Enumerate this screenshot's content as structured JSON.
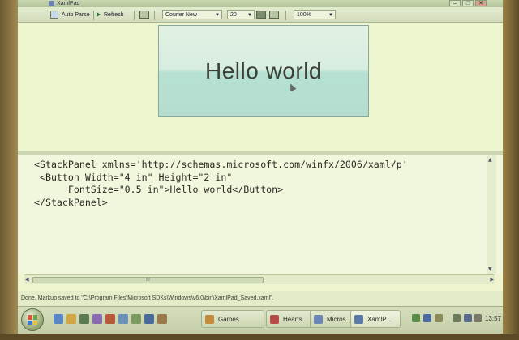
{
  "window": {
    "title": "XamlPad",
    "buttons": [
      "–",
      "□",
      "✕"
    ]
  },
  "toolbar": {
    "auto_parse_label": "Auto Parse",
    "refresh_label": "Refresh",
    "font_family": "Courier New",
    "font_size": "20",
    "zoom": "100%"
  },
  "preview": {
    "button_text": "Hello world"
  },
  "editor": {
    "lines": [
      "<StackPanel xmlns='http://schemas.microsoft.com/winfx/2006/xaml/p'",
      " <Button Width=\"4 in\" Height=\"2 in\"",
      "      FontSize=\"0.5 in\">Hello world</Button>",
      "</StackPanel>"
    ]
  },
  "scrollbar": {
    "grip": "III"
  },
  "statusbar": {
    "text": "Done. Markup saved to \"C:\\Program Files\\Microsoft SDKs\\Windows\\v6.0\\bin\\XamlPad_Saved.xaml\"."
  },
  "taskbar": {
    "items": [
      {
        "label": "Games",
        "icon": "games-icon",
        "color": "#c58a3a"
      },
      {
        "label": "Hearts",
        "icon": "hearts-icon",
        "color": "#b84a4a"
      },
      {
        "label": "Micros...",
        "icon": "document-icon",
        "color": "#6a86b8"
      },
      {
        "label": "XamlP...",
        "icon": "xamlpad-icon",
        "color": "#5a7aa8"
      }
    ],
    "clock": "13:57"
  },
  "colors": {
    "screen_bg": "#eef5cf",
    "button_glass_top": "#e2f1e3",
    "button_glass_bottom": "#b5e0d2"
  }
}
